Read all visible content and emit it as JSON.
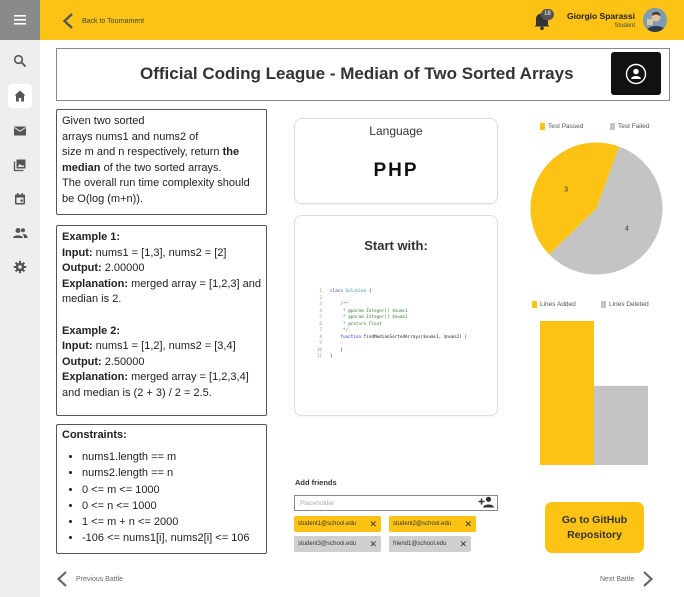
{
  "sidebar": {
    "items": [
      {
        "icon": "search-icon"
      },
      {
        "icon": "home-icon",
        "active": true
      },
      {
        "icon": "mail-icon"
      },
      {
        "icon": "gallery-icon"
      },
      {
        "icon": "calendar-icon"
      },
      {
        "icon": "people-icon"
      },
      {
        "icon": "gear-icon"
      }
    ]
  },
  "header": {
    "back_label": "Back to Tournament",
    "notification_count": "18",
    "user_name": "Giorgio Sparassi",
    "user_role": "Student"
  },
  "title": "Official Coding League - Median of Two Sorted Arrays",
  "problem": {
    "description": {
      "line1": "Given two sorted",
      "line2": "arrays nums1 and nums2 of",
      "line3_pre": "size m and n respectively, return ",
      "line3_bold": "the",
      "line4_bold": "median",
      "line4_post": " of the two sorted arrays.",
      "line5": "The overall run time complexity should",
      "line6": "be O(log (m+n))."
    },
    "examples": [
      {
        "heading": "Example 1:",
        "input_label": "Input:",
        "input": " nums1 = [1,3], nums2 = [2]",
        "output_label": "Output:",
        "output": " 2.00000",
        "explanation_label": "Explanation:",
        "explanation_1": " merged array = [1,2,3] and",
        "explanation_2": "median is 2."
      },
      {
        "heading": "Example 2:",
        "input_label": "Input:",
        "input": " nums1 = [1,2], nums2 = [3,4]",
        "output_label": "Output:",
        "output": " 2.50000",
        "explanation_label": "Explanation:",
        "explanation_1": " merged array = [1,2,3,4]",
        "explanation_2": "and median is (2 + 3) / 2 = 2.5."
      }
    ],
    "constraints_heading": "Constraints:",
    "constraints": [
      "nums1.length == m",
      "nums2.length == n",
      "0 <= m <= 1000",
      "0 <= n <= 1000",
      "1 <= m + n <= 2000",
      "-106 <= nums1[i], nums2[i] <= 106"
    ]
  },
  "language": {
    "label": "Language",
    "value": "PHP"
  },
  "start": {
    "label": "Start with:",
    "code_lines": [
      {
        "n": "1",
        "text": "class Solution {"
      },
      {
        "n": "2",
        "text": ""
      },
      {
        "n": "3",
        "text": "    /**"
      },
      {
        "n": "4",
        "text": "     * @param Integer[] $nums1"
      },
      {
        "n": "5",
        "text": "     * @param Integer[] $nums2"
      },
      {
        "n": "6",
        "text": "     * @return Float"
      },
      {
        "n": "7",
        "text": "     */"
      },
      {
        "n": "8",
        "text": "    function findMedianSortedArrays($nums1, $nums2) {"
      },
      {
        "n": "9",
        "text": ""
      },
      {
        "n": "10",
        "text": "    }"
      },
      {
        "n": "11",
        "text": "}"
      }
    ]
  },
  "friends": {
    "label": "Add friends",
    "placeholder": "Placeholder",
    "chips": [
      {
        "email": "student1@school.edu",
        "color": "yellow"
      },
      {
        "email": "student2@school.edu",
        "color": "yellow"
      },
      {
        "email": "student3@school.edu",
        "color": "gray"
      },
      {
        "email": "friend1@school.edu",
        "color": "gray"
      }
    ]
  },
  "chart_data": [
    {
      "type": "pie",
      "legend": [
        "Test Passed",
        "Test Failed"
      ],
      "values": [
        3,
        4
      ],
      "labels": [
        "3",
        "4"
      ],
      "colors": [
        "#fcc314",
        "#c4c4c4"
      ]
    },
    {
      "type": "bar",
      "legend": [
        "Lines Added",
        "Lines Deleted"
      ],
      "values": [
        100,
        55
      ],
      "colors": [
        "#fcc314",
        "#c4c4c4"
      ]
    }
  ],
  "github_button": "Go to GitHub Repository",
  "footer": {
    "prev": "Previous Battle",
    "next": "Next Battle"
  },
  "colors": {
    "accent": "#fcc314",
    "gray": "#c4c4c4"
  }
}
